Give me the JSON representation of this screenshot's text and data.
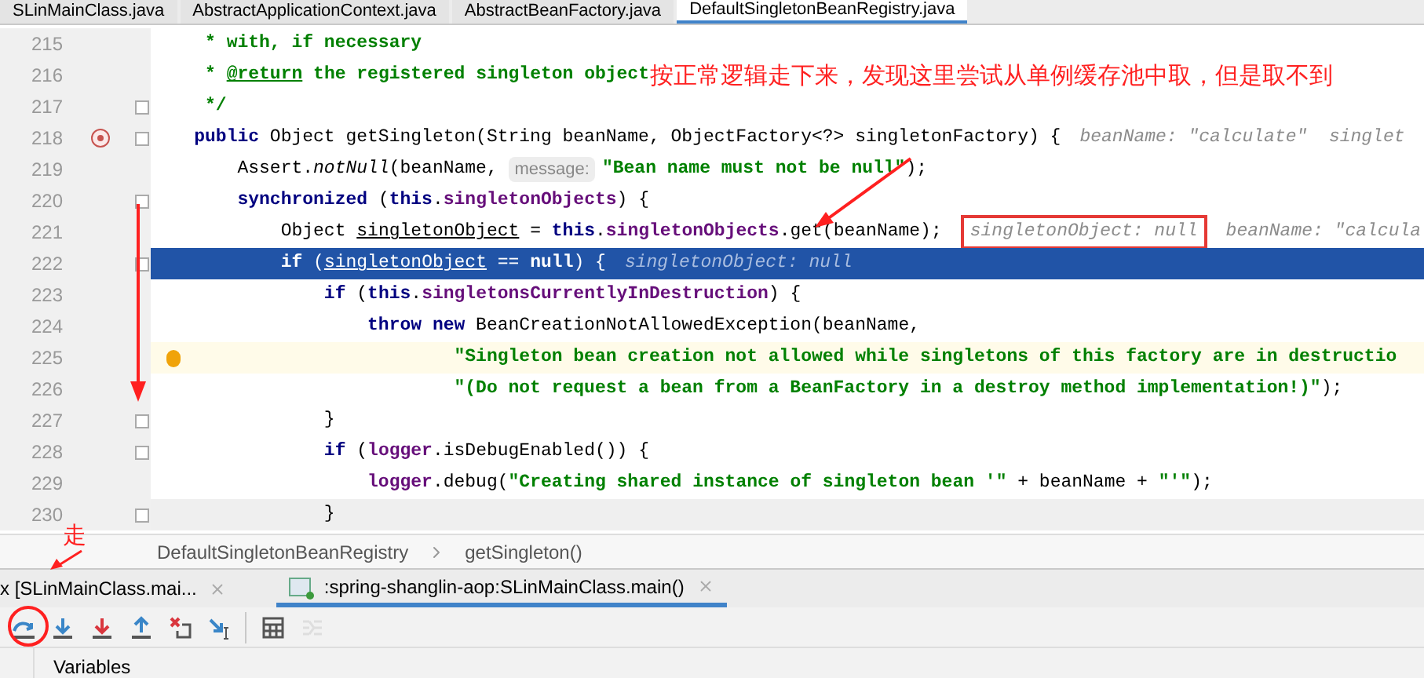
{
  "editor_tabs": [
    {
      "label": "SLinMainClass.java",
      "selected": false
    },
    {
      "label": "AbstractApplicationContext.java",
      "selected": false
    },
    {
      "label": "AbstractBeanFactory.java",
      "selected": false
    },
    {
      "label": "DefaultSingletonBeanRegistry.java",
      "selected": true
    }
  ],
  "code_lines": [
    {
      "number": "215",
      "kind": "normal",
      "segments": [
        {
          "kind": "doc",
          "text": "     * with, if necessary"
        }
      ]
    },
    {
      "number": "216",
      "kind": "normal",
      "segments": [
        {
          "kind": "doc",
          "text": "     * "
        },
        {
          "kind": "doctag",
          "text": "@return"
        },
        {
          "kind": "doc",
          "text": " the registered singleton object"
        }
      ]
    },
    {
      "number": "217",
      "kind": "normal",
      "fold": true,
      "segments": [
        {
          "kind": "doc",
          "text": "     */"
        }
      ]
    },
    {
      "number": "218",
      "kind": "normal",
      "fold": true,
      "breakpoint": true,
      "segments": [
        {
          "kind": "kw",
          "text": "    public "
        },
        {
          "kind": "text",
          "text": "Object getSingleton(String beanName, ObjectFactory<?> singletonFactory) {"
        },
        {
          "kind": "hint",
          "text": "beanName: \"calculate\"  singlet"
        }
      ]
    },
    {
      "number": "219",
      "kind": "normal",
      "segments": [
        {
          "kind": "text",
          "text": "        Assert."
        },
        {
          "kind": "static",
          "text": "notNull"
        },
        {
          "kind": "text",
          "text": "(beanName, "
        },
        {
          "kind": "inlay",
          "text": "message:"
        },
        {
          "kind": "str",
          "text": "\"Bean name must not be null\""
        },
        {
          "kind": "text",
          "text": ");"
        }
      ]
    },
    {
      "number": "220",
      "kind": "normal",
      "fold": true,
      "segments": [
        {
          "kind": "kw",
          "text": "        synchronized "
        },
        {
          "kind": "text",
          "text": "("
        },
        {
          "kind": "kw",
          "text": "this"
        },
        {
          "kind": "text",
          "text": "."
        },
        {
          "kind": "field",
          "text": "singletonObjects"
        },
        {
          "kind": "text",
          "text": ") {"
        }
      ]
    },
    {
      "number": "221",
      "kind": "normal",
      "segments": [
        {
          "kind": "text",
          "text": "            Object "
        },
        {
          "kind": "var",
          "text": "singletonObject"
        },
        {
          "kind": "text",
          "text": " = "
        },
        {
          "kind": "kw",
          "text": "this"
        },
        {
          "kind": "text",
          "text": "."
        },
        {
          "kind": "field",
          "text": "singletonObjects"
        },
        {
          "kind": "text",
          "text": ".get(beanName);"
        },
        {
          "kind": "hint",
          "text": "singletonObject: null",
          "boxed": true
        },
        {
          "kind": "hint",
          "text": "beanName: \"calcula",
          "boxed": false
        }
      ]
    },
    {
      "number": "222",
      "kind": "current",
      "fold": true,
      "segments": [
        {
          "kind": "kw",
          "text": "            if "
        },
        {
          "kind": "text",
          "text": "("
        },
        {
          "kind": "var",
          "text": "singletonObject"
        },
        {
          "kind": "text",
          "text": " == "
        },
        {
          "kind": "kw",
          "text": "null"
        },
        {
          "kind": "text",
          "text": ") {"
        },
        {
          "kind": "hint",
          "text": "singletonObject: null"
        }
      ]
    },
    {
      "number": "223",
      "kind": "normal",
      "segments": [
        {
          "kind": "kw",
          "text": "                if "
        },
        {
          "kind": "text",
          "text": "("
        },
        {
          "kind": "kw",
          "text": "this"
        },
        {
          "kind": "text",
          "text": "."
        },
        {
          "kind": "field",
          "text": "singletonsCurrentlyInDestruction"
        },
        {
          "kind": "text",
          "text": ") {"
        }
      ]
    },
    {
      "number": "224",
      "kind": "normal",
      "segments": [
        {
          "kind": "kw",
          "text": "                    throw new "
        },
        {
          "kind": "text",
          "text": "BeanCreationNotAllowedException(beanName,"
        }
      ]
    },
    {
      "number": "225",
      "kind": "warning",
      "segments": [
        {
          "kind": "str",
          "text": "                            \"Singleton bean creation not allowed while singletons of this factory are in destructio"
        }
      ]
    },
    {
      "number": "226",
      "kind": "normal",
      "segments": [
        {
          "kind": "str",
          "text": "                            \"(Do not request a bean from a BeanFactory in a destroy method implementation!)\""
        },
        {
          "kind": "text",
          "text": ");"
        }
      ]
    },
    {
      "number": "227",
      "kind": "normal",
      "fold": true,
      "segments": [
        {
          "kind": "text",
          "text": "                }"
        }
      ]
    },
    {
      "number": "228",
      "kind": "normal",
      "fold": true,
      "segments": [
        {
          "kind": "kw",
          "text": "                if "
        },
        {
          "kind": "text",
          "text": "("
        },
        {
          "kind": "field",
          "text": "logger"
        },
        {
          "kind": "text",
          "text": ".isDebugEnabled()) {"
        }
      ]
    },
    {
      "number": "229",
      "kind": "normal",
      "segments": [
        {
          "kind": "field",
          "text": "                    logger"
        },
        {
          "kind": "text",
          "text": ".debug("
        },
        {
          "kind": "str",
          "text": "\"Creating shared instance of singleton bean '\""
        },
        {
          "kind": "text",
          "text": " + beanName + "
        },
        {
          "kind": "str",
          "text": "\"'\""
        },
        {
          "kind": "text",
          "text": ");"
        }
      ]
    },
    {
      "number": "230",
      "kind": "caret",
      "fold": true,
      "segments": [
        {
          "kind": "text",
          "text": "                }"
        }
      ]
    }
  ],
  "breadcrumb": [
    "DefaultSingletonBeanRegistry",
    "getSingleton()"
  ],
  "debug_tabs": [
    {
      "label": "x [SLinMainClass.mai...",
      "selected": false
    },
    {
      "label": ":spring-shanglin-aop:SLinMainClass.main()",
      "selected": true
    }
  ],
  "toolbar": [
    {
      "kind": "step-over",
      "disabled": false
    },
    {
      "kind": "step-into",
      "disabled": false
    },
    {
      "kind": "force-step-into",
      "disabled": false
    },
    {
      "kind": "step-out",
      "disabled": false
    },
    {
      "kind": "drop-frame",
      "disabled": false
    },
    {
      "kind": "run-to-cursor",
      "disabled": false
    },
    {
      "kind": "separator"
    },
    {
      "kind": "evaluate",
      "disabled": false
    },
    {
      "kind": "trace",
      "disabled": true
    }
  ],
  "panel_title": "Variables",
  "annotations": {
    "note": "按正常逻辑走下来，发现这里尝试从单例缓存池中取，但是取不到",
    "step_note": "走"
  }
}
